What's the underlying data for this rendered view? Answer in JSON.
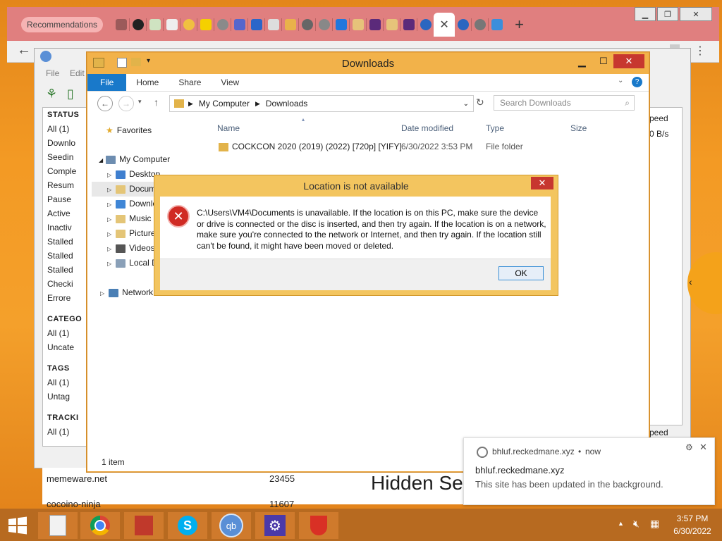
{
  "chrome": {
    "recommendations_label": "Recommendations",
    "new_tab_label": "+",
    "active_tab_close": "✕"
  },
  "qbittorrent": {
    "menu_file": "File",
    "menu_edit": "Edit",
    "status_header": "STATUS",
    "status_items": [
      "All (1)",
      "Downlo",
      "Seedin",
      "Comple",
      "Resum",
      "Pause",
      "Active",
      "Inactiv",
      "Stalled",
      "Stalled",
      "Stalled",
      "Checki",
      "Errore"
    ],
    "categories_header": "CATEGO",
    "categories_items": [
      "All (1)",
      "Uncate"
    ],
    "tags_header": "TAGS",
    "tags_items": [
      "All (1)",
      "Untag"
    ],
    "trackers_header": "TRACKI",
    "trackers_items": [
      "All (1)"
    ],
    "right_col_header": "peed",
    "right_col_value": "0 B/s",
    "right_col_footer": "peed"
  },
  "page_behind": {
    "row1_site": "memeware.net",
    "row1_value": "23455",
    "row2_site": "cocoino-ninja",
    "row2_value": "11607",
    "heading": "Hidden Se"
  },
  "explorer": {
    "title": "Downloads",
    "ribbon_tabs": [
      "File",
      "Home",
      "Share",
      "View"
    ],
    "breadcrumb": [
      "My Computer",
      "Downloads"
    ],
    "search_placeholder": "Search Downloads",
    "nav": {
      "favorites": "Favorites",
      "my_computer": "My Computer",
      "children": [
        "Desktop",
        "Docum",
        "Downlo",
        "Music",
        "Picture",
        "Videos",
        "Local D"
      ],
      "network": "Network"
    },
    "columns": [
      "Name",
      "Date modified",
      "Type",
      "Size"
    ],
    "files": [
      {
        "name": "COCKCON 2020 (2019) (2022) [720p] [YIFY]",
        "modified": "6/30/2022 3:53 PM",
        "type": "File folder",
        "size": ""
      }
    ],
    "status": "1 item"
  },
  "dialog": {
    "title": "Location is not available",
    "message": "C:\\Users\\VM4\\Documents is unavailable. If the location is on this PC, make sure the device or drive is connected or the disc is inserted, and then try again. If the location is on a network, make sure you're connected to the network or Internet, and then try again. If the location still can't be found, it might have been moved or deleted.",
    "ok_label": "OK",
    "close_label": "✕"
  },
  "notification": {
    "source": "bhluf.reckedmane.xyz",
    "time": "now",
    "separator": "•",
    "title": "bhluf.reckedmane.xyz",
    "body": "This site has been updated in the background."
  },
  "taskbar": {
    "time": "3:57 PM",
    "date": "6/30/2022"
  }
}
